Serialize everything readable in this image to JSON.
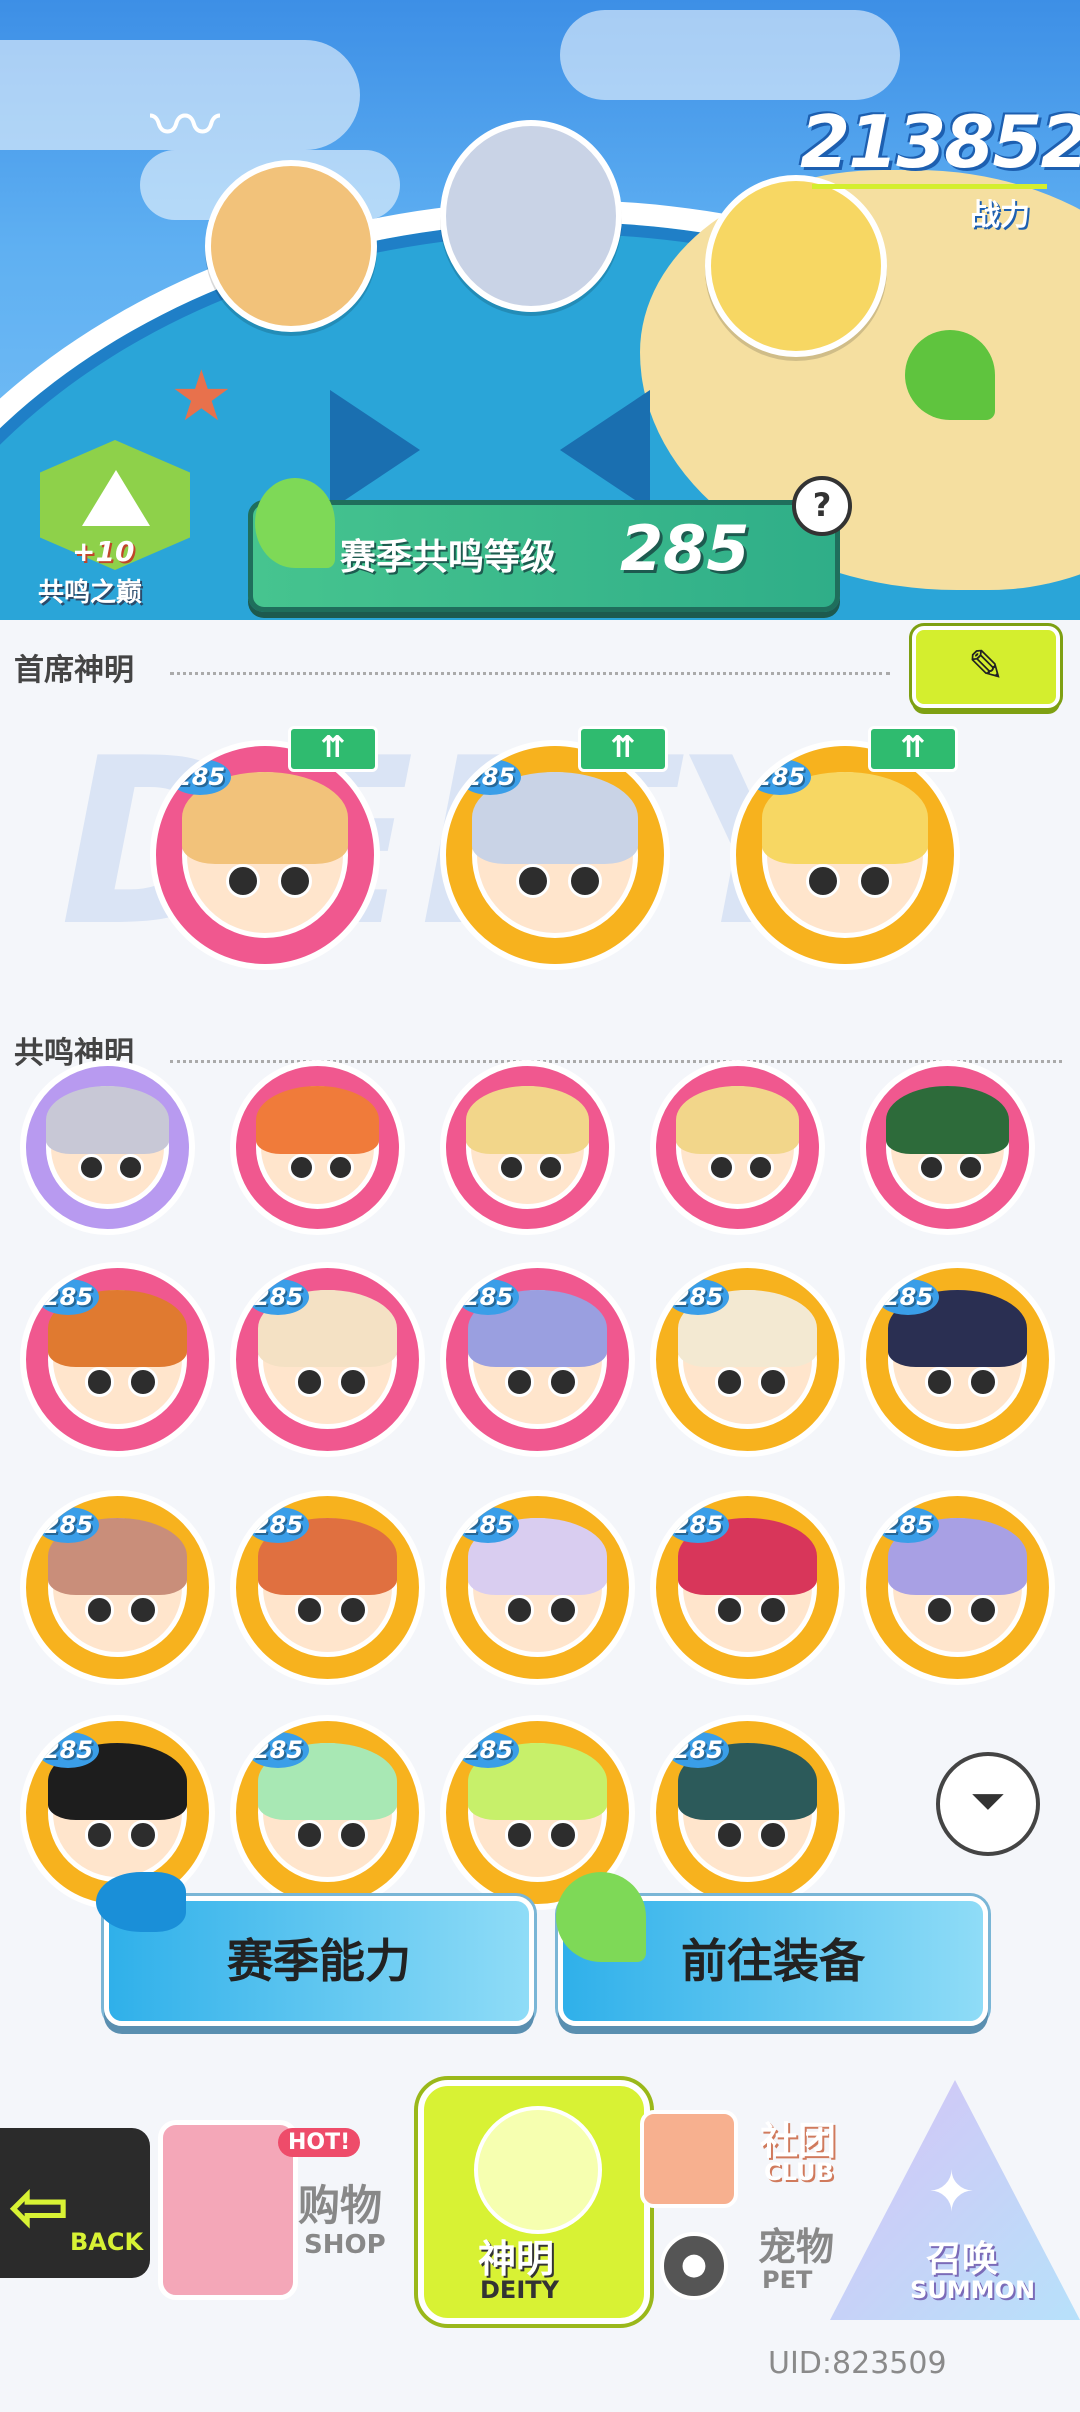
{
  "header": {
    "power_value": "213852",
    "power_label": "战力",
    "peak_plus": "+10",
    "peak_label": "共鸣之巅",
    "season_level_title": "赛季共鸣等级",
    "season_level_value": "285",
    "help_icon": "question-icon"
  },
  "chief_section": {
    "title": "首席神明",
    "edit_icon": "pencil-icon",
    "watermark": "DEITY",
    "deities": [
      {
        "level": "285",
        "frame_color": "#f0588f",
        "hair": "#f2c27a",
        "upgrade": "up-arrows-icon"
      },
      {
        "level": "285",
        "frame_color": "#f7b21e",
        "hair": "#c9d3e6",
        "upgrade": "up-arrows-icon"
      },
      {
        "level": "285",
        "frame_color": "#f7b21e",
        "hair": "#f7d763",
        "upgrade": "up-arrows-icon"
      }
    ]
  },
  "resonance_section": {
    "title": "共鸣神明",
    "filter_icon": "filter-icon",
    "rows": [
      [
        {
          "level": "",
          "frame_color": "#b89af0",
          "hair": "#c8c8d6"
        },
        {
          "level": "",
          "frame_color": "#f0588f",
          "hair": "#f07b3a"
        },
        {
          "level": "",
          "frame_color": "#f0588f",
          "hair": "#f2d68a"
        },
        {
          "level": "",
          "frame_color": "#f0588f",
          "hair": "#f2d68a"
        },
        {
          "level": "",
          "frame_color": "#f0588f",
          "hair": "#2d6b3a"
        }
      ],
      [
        {
          "level": "285",
          "frame_color": "#f0588f",
          "hair": "#e07a30"
        },
        {
          "level": "285",
          "frame_color": "#f0588f",
          "hair": "#f4e1c4"
        },
        {
          "level": "285",
          "frame_color": "#f0588f",
          "hair": "#9a9fe0"
        },
        {
          "level": "285",
          "frame_color": "#f7b21e",
          "hair": "#f3e9d2"
        },
        {
          "level": "285",
          "frame_color": "#f7b21e",
          "hair": "#2a2f52"
        }
      ],
      [
        {
          "level": "285",
          "frame_color": "#f7b21e",
          "hair": "#c98e7a"
        },
        {
          "level": "285",
          "frame_color": "#f7b21e",
          "hair": "#e07040"
        },
        {
          "level": "285",
          "frame_color": "#f7b21e",
          "hair": "#d9cdf0"
        },
        {
          "level": "285",
          "frame_color": "#f7b21e",
          "hair": "#d8365a"
        },
        {
          "level": "285",
          "frame_color": "#f7b21e",
          "hair": "#a8a0e4"
        }
      ],
      [
        {
          "level": "285",
          "frame_color": "#f7b21e",
          "hair": "#1d1d1d"
        },
        {
          "level": "285",
          "frame_color": "#f7b21e",
          "hair": "#a8e8b4"
        },
        {
          "level": "285",
          "frame_color": "#f7b21e",
          "hair": "#c7f06a"
        },
        {
          "level": "285",
          "frame_color": "#f7b21e",
          "hair": "#2c5a5a"
        }
      ]
    ]
  },
  "actions": {
    "season_ability": "赛季能力",
    "go_equipment": "前往装备"
  },
  "bottom_nav": {
    "back": "BACK",
    "shop_cn": "购物",
    "shop_en": "SHOP",
    "shop_hot": "HOT!",
    "deity_cn": "神明",
    "deity_en": "DEITY",
    "club_cn": "社团",
    "club_en": "CLUB",
    "pet_cn": "宠物",
    "pet_en": "PET",
    "summon_cn": "召唤",
    "summon_en": "SUMMON"
  },
  "uid": "UID:823509"
}
